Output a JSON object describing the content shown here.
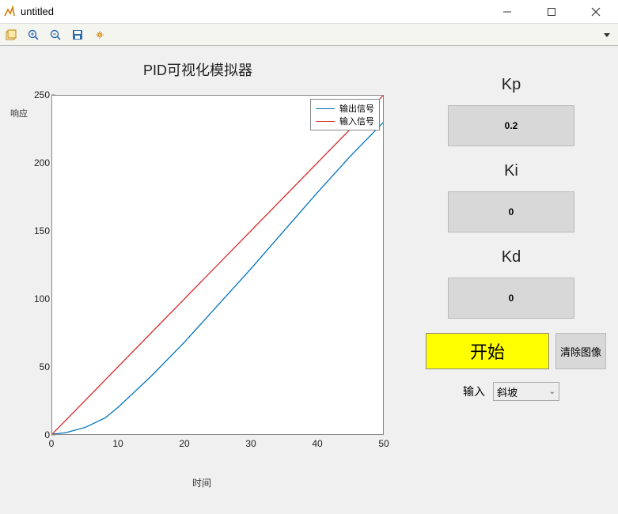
{
  "window": {
    "title": "untitled"
  },
  "chart_data": {
    "type": "line",
    "title": "PID可视化模拟器",
    "xlabel": "时间",
    "ylabel": "响应",
    "xlim": [
      0,
      50
    ],
    "ylim": [
      0,
      250
    ],
    "xticks": [
      0,
      10,
      20,
      30,
      40,
      50
    ],
    "yticks": [
      0,
      50,
      100,
      150,
      200,
      250
    ],
    "series": [
      {
        "name": "输出信号",
        "color": "#0072BD",
        "x": [
          0,
          2,
          5,
          8,
          10,
          15,
          20,
          25,
          30,
          35,
          40,
          45,
          50
        ],
        "y": [
          0,
          1,
          5,
          12,
          20,
          43,
          68,
          95,
          122,
          150,
          178,
          205,
          230
        ]
      },
      {
        "name": "输入信号",
        "color": "#D62728",
        "x": [
          0,
          50
        ],
        "y": [
          0,
          250
        ]
      }
    ],
    "legend_position": "top-right"
  },
  "controls": {
    "kp": {
      "label": "Kp",
      "value": "0.2"
    },
    "ki": {
      "label": "Ki",
      "value": "0"
    },
    "kd": {
      "label": "Kd",
      "value": "0"
    },
    "start_label": "开始",
    "clear_label": "清除图像",
    "input_label": "输入",
    "input_selected": "斜坡"
  }
}
